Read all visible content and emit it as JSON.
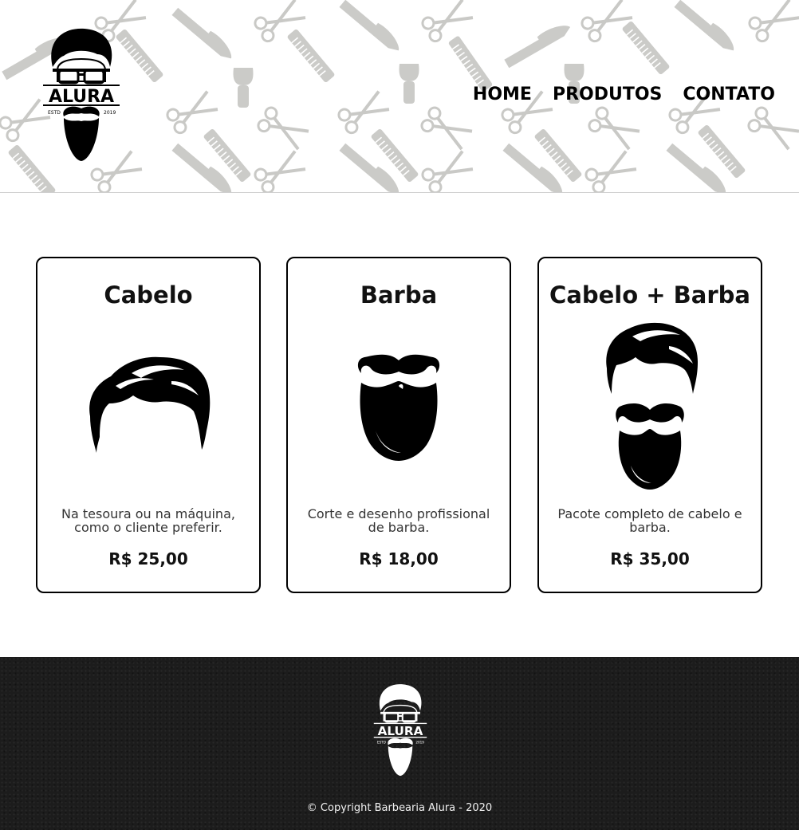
{
  "header": {
    "logo": {
      "name": "ALURA",
      "est_label": "ESTD",
      "year": "2019"
    },
    "nav": [
      {
        "label": "HOME"
      },
      {
        "label": "PRODUTOS"
      },
      {
        "label": "CONTATO"
      }
    ]
  },
  "products": [
    {
      "title": "Cabelo",
      "icon": "hair-icon",
      "description": "Na tesoura ou na máquina, como o cliente preferir.",
      "price": "R$ 25,00"
    },
    {
      "title": "Barba",
      "icon": "beard-icon",
      "description": "Corte e desenho profissional de barba.",
      "price": "R$ 18,00"
    },
    {
      "title": "Cabelo + Barba",
      "icon": "hair-and-beard-icon",
      "description": "Pacote completo de cabelo e barba.",
      "price": "R$ 35,00"
    }
  ],
  "footer": {
    "logo": {
      "name": "ALURA",
      "est_label": "ESTD",
      "year": "2019"
    },
    "copyright": "© Copyright Barbearia Alura - 2020"
  },
  "colors": {
    "text": "#000000",
    "footer_bg": "#1c1c1c",
    "pattern": "#cccccc",
    "card_border": "#000000"
  }
}
